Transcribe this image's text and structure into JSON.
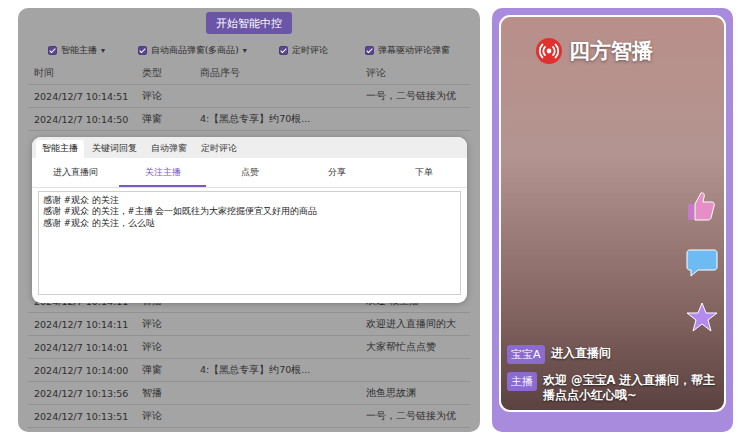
{
  "start_button": "开始智能中控",
  "options": [
    {
      "label": "智能主播",
      "checked": true,
      "dropdown": "▾"
    },
    {
      "label": "自动商品弹窗(多商品)",
      "checked": true,
      "dropdown": "▾"
    },
    {
      "label": "定时评论",
      "checked": true,
      "dropdown": ""
    },
    {
      "label": "弹幕驱动评论弹窗",
      "checked": true,
      "dropdown": ""
    }
  ],
  "table": {
    "columns": [
      "时间",
      "类型",
      "商品序号",
      "评论"
    ],
    "rows": [
      [
        "2024/12/7 10:14:51",
        "评论",
        "",
        "一号，二号链接为优"
      ],
      [
        "2024/12/7 10:14:50",
        "弹窗",
        "4:【黑总专享】约70根...",
        ""
      ],
      [
        "2024/12/7 10:14:11",
        "智播",
        "",
        "欢迎 核主播"
      ],
      [
        "2024/12/7 10:14:11",
        "评论",
        "",
        "欢迎进入直播间的大"
      ],
      [
        "2024/12/7 10:14:01",
        "评论",
        "",
        "大家帮忙点点赞"
      ],
      [
        "2024/12/7 10:14:00",
        "弹窗",
        "4:【黑总专享】约70根...",
        ""
      ],
      [
        "2024/12/7 10:13:56",
        "智播",
        "",
        "池鱼思故渊"
      ],
      [
        "2024/12/7 10:13:51",
        "评论",
        "",
        "一号，二号链接为优"
      ]
    ]
  },
  "dialog": {
    "tabs": [
      {
        "label": "智能主播",
        "selected": true
      },
      {
        "label": "关键词回复",
        "selected": false
      },
      {
        "label": "自动弹窗",
        "selected": false
      },
      {
        "label": "定时评论",
        "selected": false
      }
    ],
    "events": [
      {
        "label": "进入直播间",
        "selected": false
      },
      {
        "label": "关注主播",
        "selected": true
      },
      {
        "label": "点赞",
        "selected": false
      },
      {
        "label": "分享",
        "selected": false
      },
      {
        "label": "下单",
        "selected": false
      }
    ],
    "text_lines": [
      "感谢 #观众 的关注",
      "感谢 #观众 的关注，#主播 会一如既往为大家挖掘便宜又好用的商品",
      "感谢 #观众 的关注，么么哒"
    ]
  },
  "preview": {
    "logo": "四方智播",
    "messages": [
      {
        "tag": "宝宝A",
        "text": "进入直播间"
      },
      {
        "tag": "主播",
        "text": "欢迎 @宝宝A 进入直播间，帮主播点点小红心哦~"
      }
    ]
  }
}
